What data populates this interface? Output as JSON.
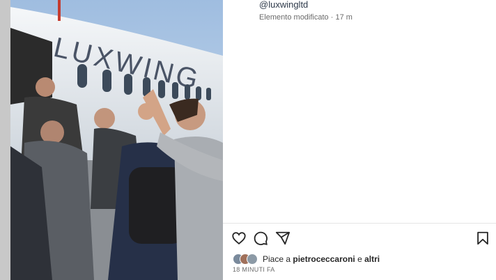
{
  "post": {
    "username": "@luxwingltd",
    "edited_label": "Elemento modificato",
    "separator": "·",
    "edited_time": "17 m",
    "aircraft_text": "LUXWING"
  },
  "actions": {
    "like_icon": "heart-icon",
    "comment_icon": "comment-icon",
    "share_icon": "paper-plane-icon",
    "save_icon": "bookmark-icon"
  },
  "likes": {
    "prefix": "Piace a",
    "user": "pietroceccaroni",
    "connector": "e",
    "others": "altri"
  },
  "time_ago": "18 MINUTI FA",
  "colors": {
    "sky": "#b9d2ea",
    "fuselage": "#eef1f4",
    "text_secondary": "#6b6b6b",
    "username": "#2e3a4a"
  }
}
